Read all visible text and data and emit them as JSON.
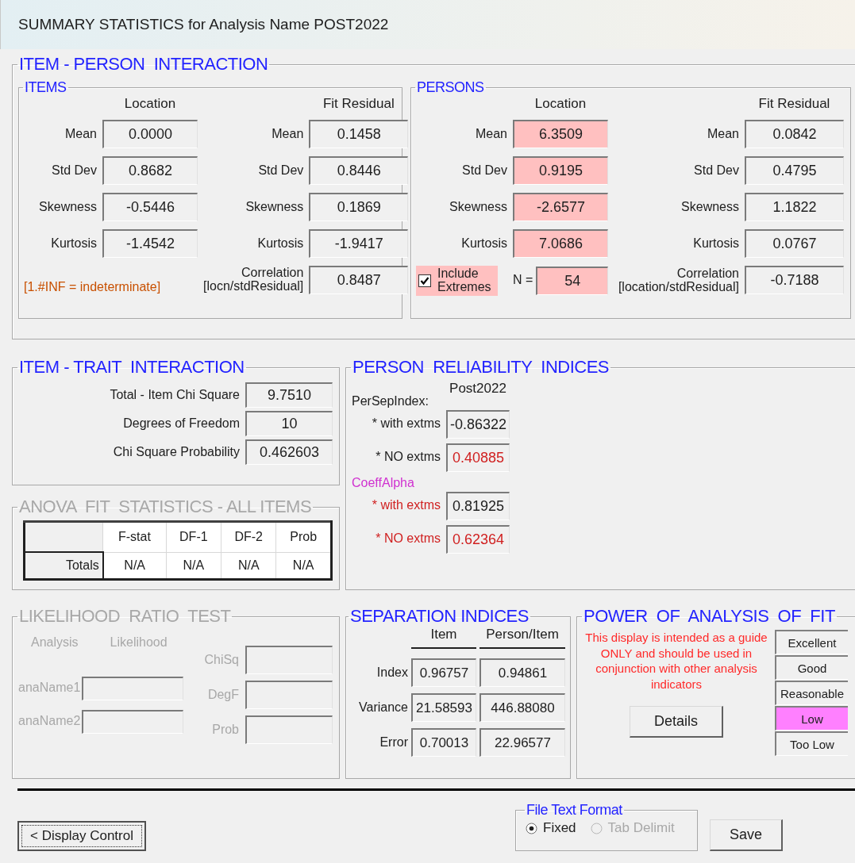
{
  "window": {
    "title": "SUMMARY STATISTICS for Analysis Name POST2022"
  },
  "item_person_interaction": {
    "title": "ITEM - PERSON  INTERACTION",
    "items": {
      "title": "ITEMS",
      "location_header": "Location",
      "fit_header": "Fit Residual",
      "location": [
        {
          "label": "Mean",
          "value": "0.0000",
          "flagged": false
        },
        {
          "label": "Std Dev",
          "value": "0.8682",
          "flagged": false
        },
        {
          "label": "Skewness",
          "value": "-0.5446",
          "flagged": false
        },
        {
          "label": "Kurtosis",
          "value": "-1.4542",
          "flagged": false
        }
      ],
      "fit_residual": [
        {
          "label": "Mean",
          "value": "0.1458"
        },
        {
          "label": "Std Dev",
          "value": "0.8446"
        },
        {
          "label": "Skewness",
          "value": "0.1869"
        },
        {
          "label": "Kurtosis",
          "value": "-1.9417"
        }
      ],
      "note": "[1.#INF = indeterminate]",
      "correlation": {
        "label": "Correlation\n[locn/stdResidual]",
        "value": "0.8487"
      }
    },
    "persons": {
      "title": "PERSONS",
      "location_header": "Location",
      "fit_header": "Fit Residual",
      "location": [
        {
          "label": "Mean",
          "value": "6.3509",
          "flagged": true
        },
        {
          "label": "Std Dev",
          "value": "0.9195",
          "flagged": true
        },
        {
          "label": "Skewness",
          "value": "-2.6577",
          "flagged": true
        },
        {
          "label": "Kurtosis",
          "value": "7.0686",
          "flagged": true
        }
      ],
      "fit_residual": [
        {
          "label": "Mean",
          "value": "0.0842"
        },
        {
          "label": "Std Dev",
          "value": "0.4795"
        },
        {
          "label": "Skewness",
          "value": "1.1822"
        },
        {
          "label": "Kurtosis",
          "value": "0.0767"
        }
      ],
      "include_extremes": {
        "label": "Include\nExtremes",
        "checked": true
      },
      "n": {
        "label": "N =",
        "value": "54",
        "flagged": true
      },
      "correlation": {
        "label": "Correlation\n[location/stdResidual]",
        "value": "-0.7188"
      }
    }
  },
  "item_trait_interaction": {
    "title": "ITEM - TRAIT  INTERACTION",
    "rows": [
      {
        "label": "Total - Item Chi Square",
        "value": "9.7510"
      },
      {
        "label": "Degrees of Freedom",
        "value": "10"
      },
      {
        "label": "Chi Square Probability",
        "value": "0.462603"
      }
    ]
  },
  "anova": {
    "title": "ANOVA  FIT  STATISTICS - ALL ITEMS",
    "disabled": true,
    "columns": [
      "F-stat",
      "DF-1",
      "DF-2",
      "Prob"
    ],
    "rows": [
      {
        "label": "Totals",
        "cells": [
          "N/A",
          "N/A",
          "N/A",
          "N/A"
        ]
      }
    ]
  },
  "person_reliability": {
    "title": "PERSON  RELIABILITY  INDICES",
    "column_header": "Post2022",
    "groups": [
      {
        "heading": "PerSepIndex:",
        "color": "#202020",
        "rows": [
          {
            "label": "* with extms",
            "value": "-0.86322",
            "label_alert": false,
            "value_alert": false
          },
          {
            "label": "* NO extms",
            "value": "0.40885",
            "label_alert": false,
            "value_alert": true
          }
        ]
      },
      {
        "heading": "CoeffAlpha",
        "color": "#d030d0",
        "rows": [
          {
            "label": "* with extms",
            "value": "0.81925",
            "label_alert": true,
            "value_alert": false
          },
          {
            "label": "* NO extms",
            "value": "0.62364",
            "label_alert": true,
            "value_alert": true
          }
        ]
      }
    ]
  },
  "likelihood_ratio": {
    "title": "LIKELIHOOD  RATIO  TEST",
    "disabled": true,
    "headers": [
      "Analysis",
      "Likelihood"
    ],
    "names": [
      {
        "label": "anaName1"
      },
      {
        "label": "anaName2"
      }
    ],
    "stats": [
      {
        "label": "ChiSq"
      },
      {
        "label": "DegF"
      },
      {
        "label": "Prob"
      }
    ]
  },
  "separation": {
    "title": "SEPARATION INDICES",
    "columns": [
      "Item",
      "Person/Item"
    ],
    "rows": [
      {
        "label": "Index",
        "values": [
          "0.96757",
          "0.94861"
        ]
      },
      {
        "label": "Variance",
        "values": [
          "21.58593",
          "446.88080"
        ]
      },
      {
        "label": "Error",
        "values": [
          "0.70013",
          "22.96577"
        ]
      }
    ]
  },
  "power": {
    "title": "POWER  OF  ANALYSIS  OF  FIT",
    "note": "This display is intended as a guide ONLY and should be used in conjunction with other analysis indicators",
    "button": "Details",
    "levels": [
      {
        "label": "Excellent",
        "selected": false
      },
      {
        "label": "Good",
        "selected": false
      },
      {
        "label": "Reasonable",
        "selected": false
      },
      {
        "label": "Low",
        "selected": true
      },
      {
        "label": "Too Low",
        "selected": false
      }
    ]
  },
  "footer": {
    "display_control": "< Display Control",
    "file_text_format": {
      "title": "File Text Format",
      "options": [
        {
          "label": "Fixed",
          "selected": true,
          "disabled": false
        },
        {
          "label": "Tab Delimit",
          "selected": false,
          "disabled": true
        }
      ]
    },
    "save": "Save"
  }
}
